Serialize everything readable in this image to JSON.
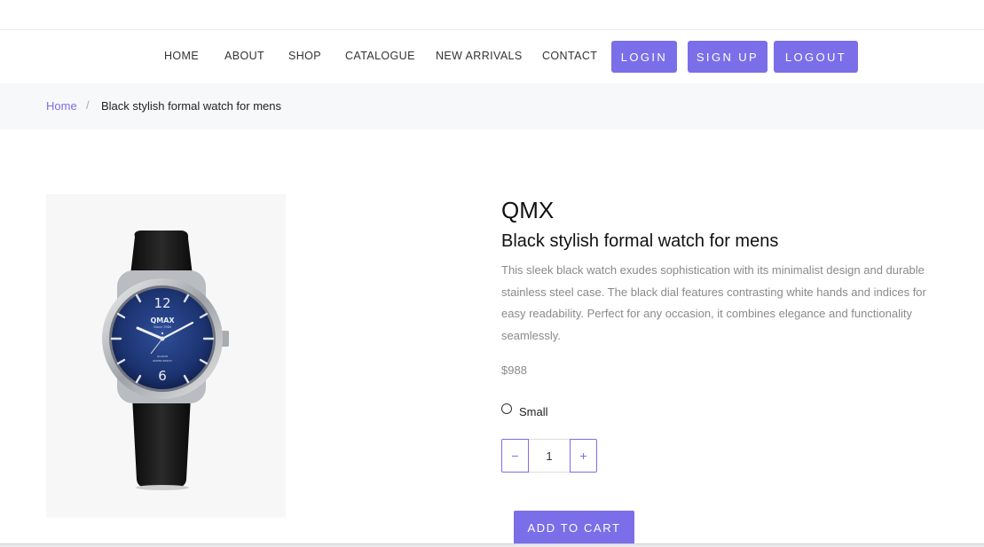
{
  "nav": {
    "links": [
      "HOME",
      "ABOUT",
      "SHOP",
      "CATALOGUE",
      "NEW ARRIVALS",
      "CONTACT"
    ],
    "login": "LOGIN",
    "signup": "SIGN UP",
    "logout": "LOGOUT"
  },
  "breadcrumb": {
    "home": "Home",
    "separator": "/",
    "current": "Black stylish formal watch for mens"
  },
  "product": {
    "brand": "QMX",
    "title": "Black stylish formal watch for mens",
    "description": "This sleek black watch exudes sophistication with its minimalist design and durable stainless steel case. The black dial features contrasting white hands and indices for easy readability. Perfect for any occasion, it combines elegance and functionality seamlessly.",
    "price": "$988",
    "size_option": "Small",
    "quantity": "1",
    "minus": "−",
    "plus": "+",
    "add_to_cart": "ADD TO CART",
    "image": {
      "dial_brand": "QMAX",
      "dial_sub": "Since 1946",
      "dial_bottom1": "QUARTZ",
      "dial_bottom2": "WATER RESIST",
      "n12": "12",
      "n6": "6"
    }
  },
  "colors": {
    "accent": "#7b6ee9",
    "breadcrumb_bg": "#f7f8fa",
    "muted_text": "#8a8a8a"
  }
}
